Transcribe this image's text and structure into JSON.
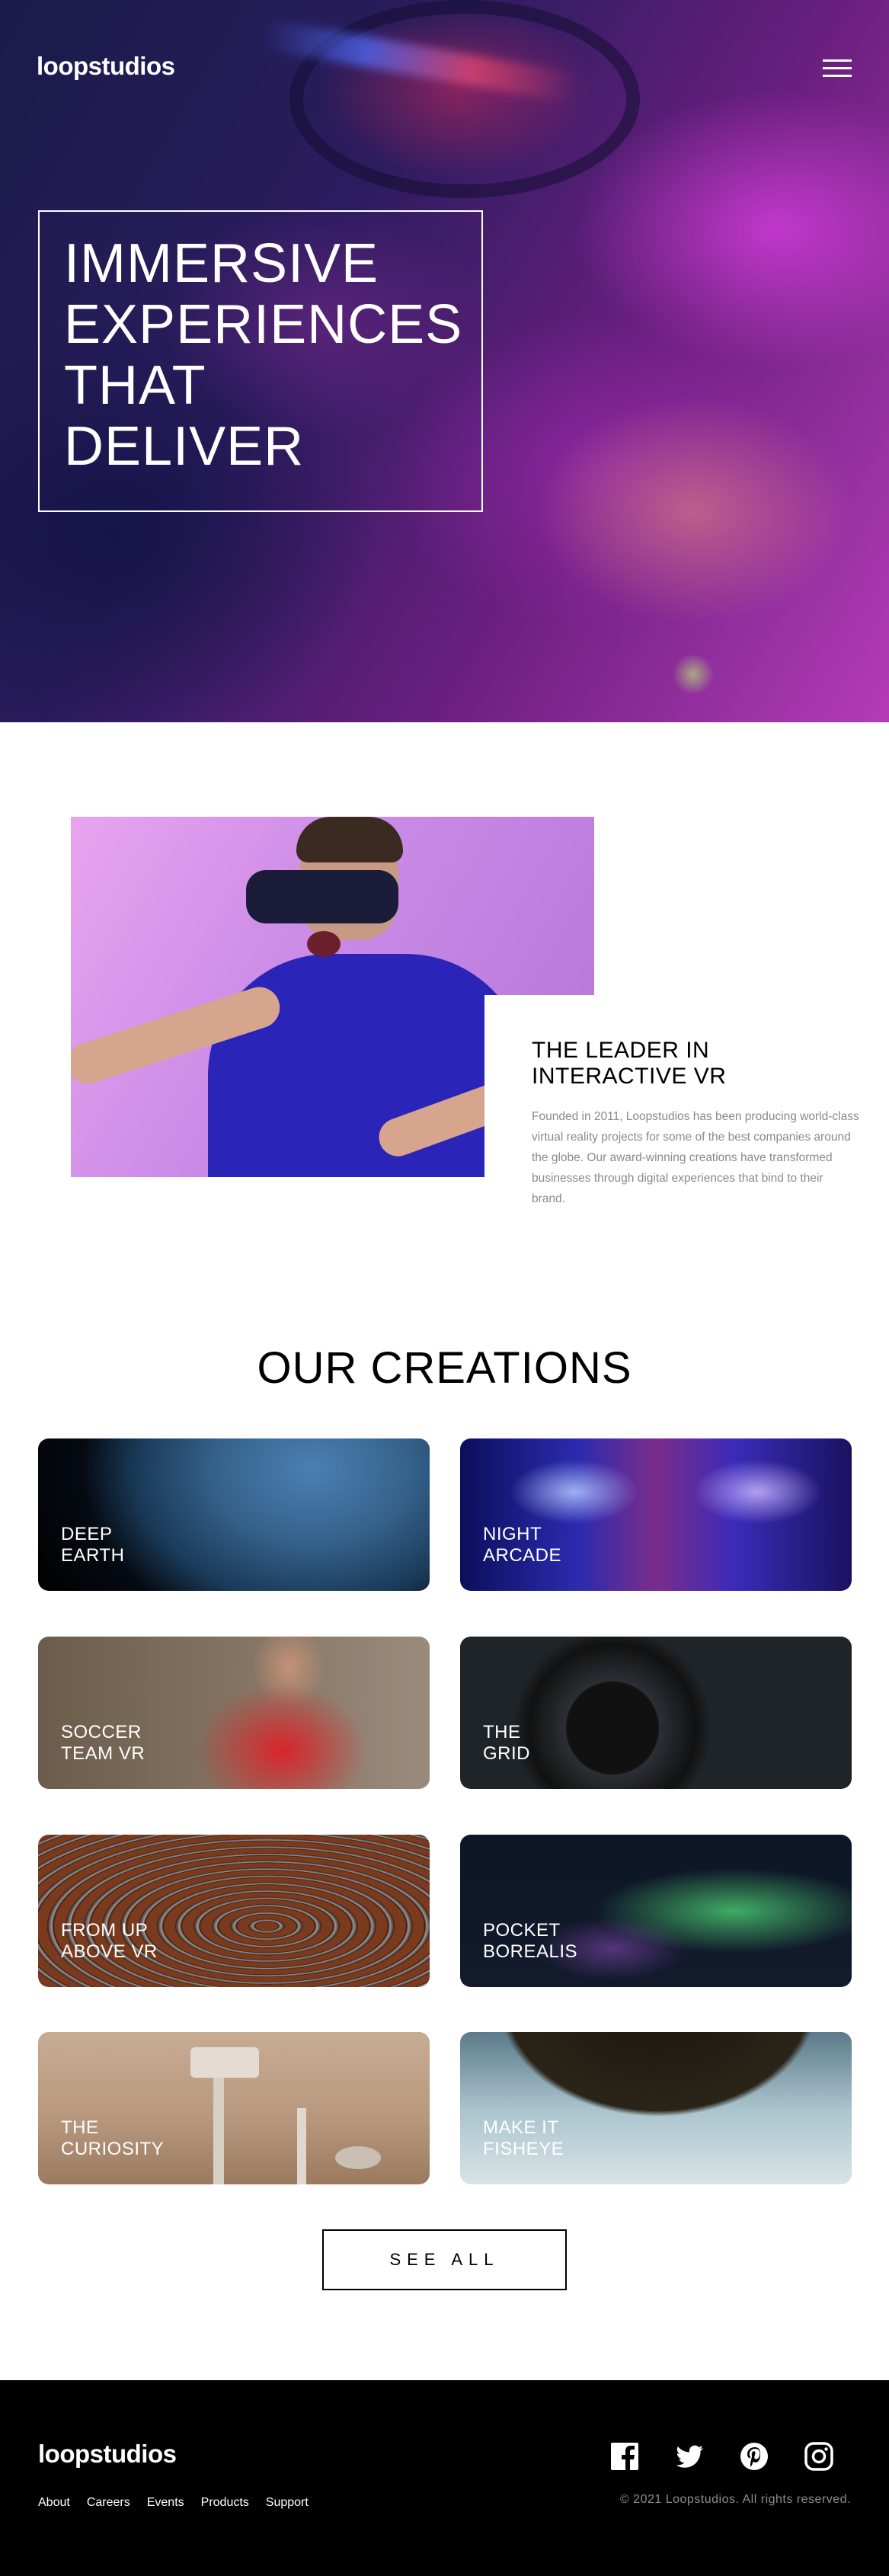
{
  "brand": {
    "logo": "loopstudios"
  },
  "hero": {
    "title_lines": [
      "IMMERSIVE",
      "EXPERIENCES",
      "THAT",
      "DELIVER"
    ]
  },
  "about": {
    "title": "THE LEADER IN INTERACTIVE VR",
    "text": "Founded in 2011, Loopstudios has been producing world-class virtual reality projects for some of the best companies around the globe. Our award-winning creations have transformed businesses through digital experiences that bind to their brand."
  },
  "creations": {
    "title": "OUR CREATIONS",
    "items": [
      {
        "line1": "DEEP",
        "line2": "EARTH"
      },
      {
        "line1": "NIGHT",
        "line2": "ARCADE"
      },
      {
        "line1": "SOCCER",
        "line2": "TEAM VR"
      },
      {
        "line1": "THE",
        "line2": "GRID"
      },
      {
        "line1": "FROM UP",
        "line2": "ABOVE VR"
      },
      {
        "line1": "POCKET",
        "line2": "BOREALIS"
      },
      {
        "line1": "THE",
        "line2": "CURIOSITY"
      },
      {
        "line1": "MAKE IT",
        "line2": "FISHEYE"
      }
    ],
    "see_all": "SEE ALL"
  },
  "footer": {
    "logo": "loopstudios",
    "nav": [
      "About",
      "Careers",
      "Events",
      "Products",
      "Support"
    ],
    "social_icons": [
      "facebook-icon",
      "twitter-icon",
      "pinterest-icon",
      "instagram-icon"
    ],
    "copyright": "© 2021 Loopstudios. All rights reserved."
  },
  "colors": {
    "footer_bg": "#000000",
    "text_muted": "#8a8a8a"
  }
}
